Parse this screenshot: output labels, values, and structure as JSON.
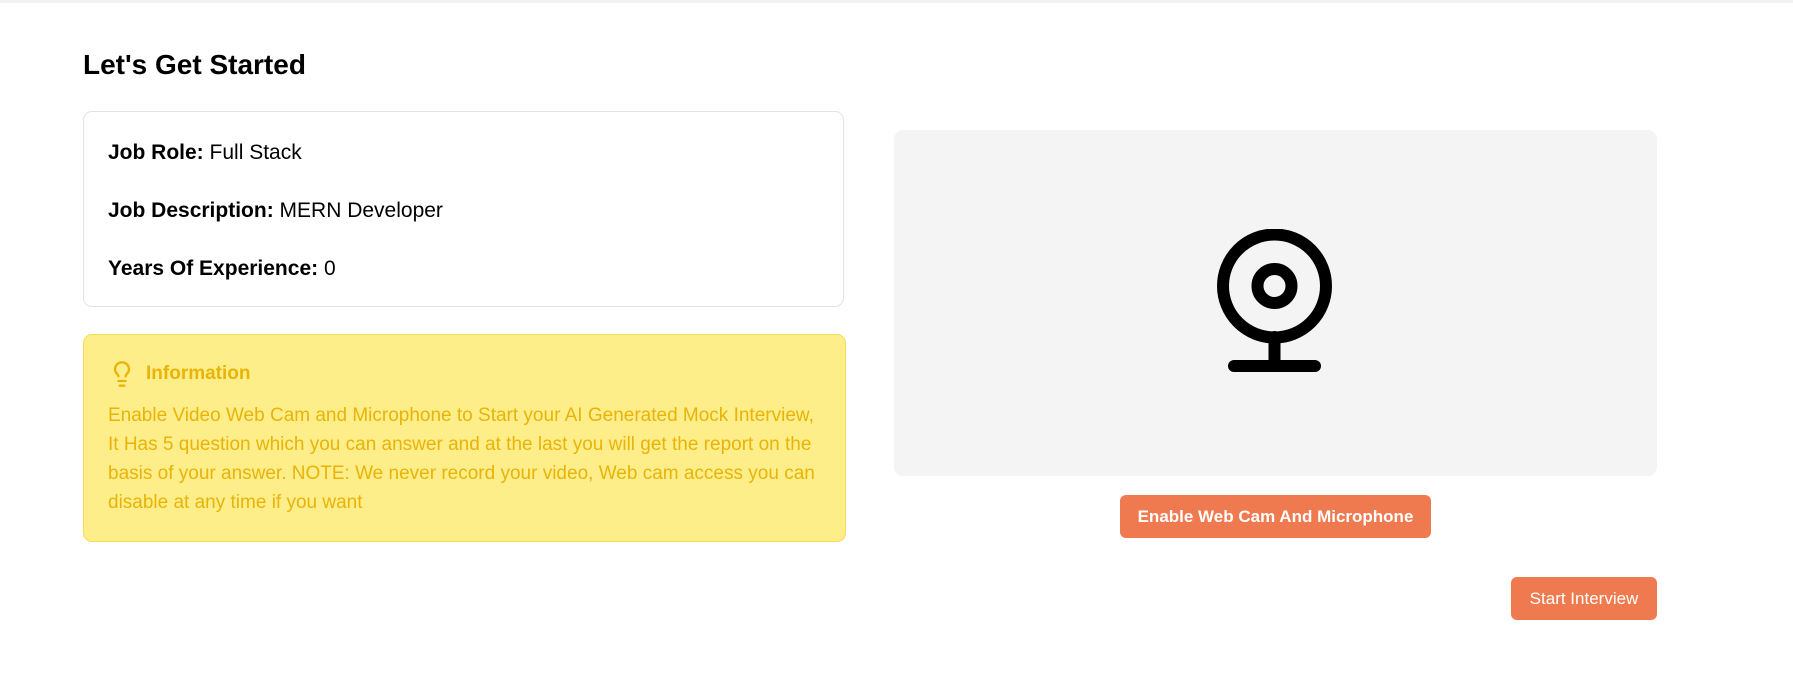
{
  "page": {
    "title": "Let's Get Started"
  },
  "details": {
    "job_role": {
      "label": "Job Role:",
      "value": "Full Stack"
    },
    "job_description": {
      "label": "Job Description:",
      "value": "MERN Developer"
    },
    "years_experience": {
      "label": "Years Of Experience:",
      "value": "0"
    }
  },
  "info": {
    "icon": "lightbulb-icon",
    "title": "Information",
    "text": "Enable Video Web Cam and Microphone to Start your AI Generated Mock Interview, It Has 5 question which you can answer and at the last you will get the report on the basis of your answer. NOTE: We never record your video, Web cam access you can disable at any time if you want"
  },
  "webcam": {
    "icon": "webcam-icon",
    "enable_button_label": "Enable Web Cam And Microphone"
  },
  "actions": {
    "start_interview_label": "Start Interview"
  },
  "colors": {
    "accent": "#f07a50",
    "info_background": "#fdee8a",
    "info_text": "#eab308",
    "panel_background": "#f4f4f4"
  }
}
